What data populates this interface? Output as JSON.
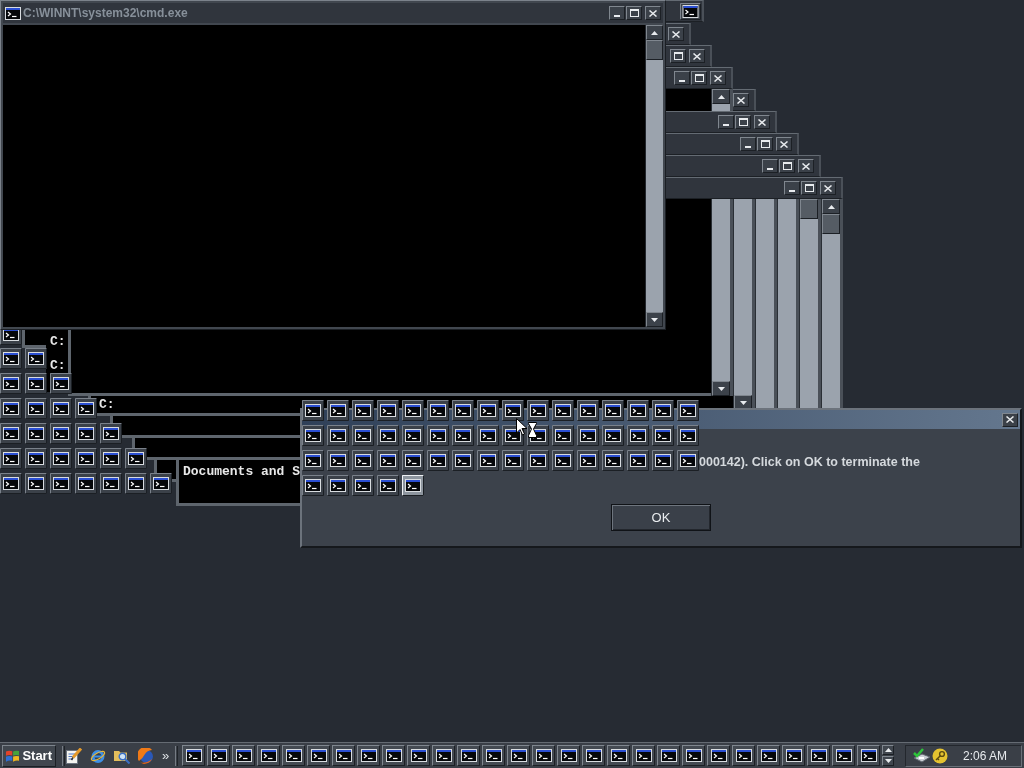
{
  "main_window": {
    "title": "C:\\WINNT\\system32\\cmd.exe",
    "active": false
  },
  "console_fragments": [
    {
      "lines": [
        "C:",
        "C:"
      ]
    },
    {
      "lines": [
        "C:"
      ]
    },
    {
      "lines": [
        "Documents and S"
      ]
    }
  ],
  "dialog": {
    "active": true,
    "message": "000142). Click on OK to terminate the",
    "buttons": [
      "OK"
    ]
  },
  "dialog_overlay_tiles": [
    {
      "selected": false
    },
    {
      "selected": false
    },
    {
      "selected": false
    },
    {
      "selected": false
    },
    {
      "selected": true
    }
  ],
  "taskbar": {
    "start_button": "Start",
    "more_button": "»",
    "clock": "2:06 AM"
  }
}
